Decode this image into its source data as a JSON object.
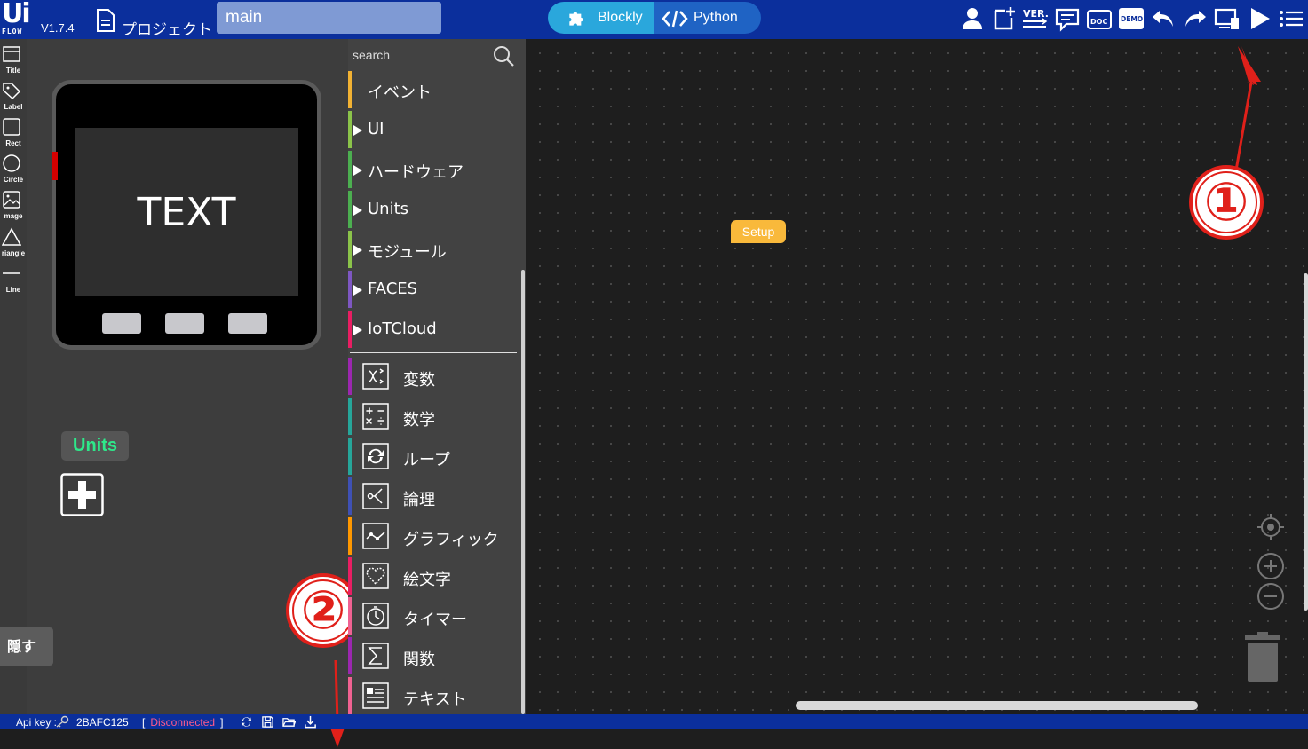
{
  "header": {
    "logo_ui": "Ui",
    "logo_flow": "FLOW",
    "version": "V1.7.4",
    "project_label": "プロジェクト",
    "filename": "main",
    "mode_blockly": "Blockly",
    "mode_python": "Python",
    "toolbar_icons": [
      "user-icon",
      "new-file-icon",
      "version-icon",
      "message-icon",
      "doc-icon",
      "demo-icon",
      "undo-icon",
      "redo-icon",
      "device-icon",
      "run-icon",
      "menu-icon"
    ],
    "ver_text": "VER.",
    "doc_text": "DOC",
    "demo_text": "DEMO"
  },
  "tools": [
    {
      "name": "Title",
      "icon": "title-icon"
    },
    {
      "name": "Label",
      "icon": "label-icon"
    },
    {
      "name": "Rect",
      "icon": "rect-icon"
    },
    {
      "name": "Circle",
      "icon": "circle-icon"
    },
    {
      "name": "mage",
      "icon": "image-icon"
    },
    {
      "name": "riangle",
      "icon": "triangle-icon"
    },
    {
      "name": "Line",
      "icon": "line-icon"
    }
  ],
  "device": {
    "screen_text": "TEXT",
    "units_label": "Units",
    "hide_label": "隠す"
  },
  "categories": {
    "search_placeholder": "search",
    "expandable": [
      {
        "label": "イベント",
        "color": "#f2b233",
        "arrow": false
      },
      {
        "label": "UI",
        "color": "#8bc34a",
        "arrow": true
      },
      {
        "label": "ハードウェア",
        "color": "#4caf50",
        "arrow": true
      },
      {
        "label": "Units",
        "color": "#4caf50",
        "arrow": true
      },
      {
        "label": "モジュール",
        "color": "#8bc34a",
        "arrow": true
      },
      {
        "label": "FACES",
        "color": "#7e57c2",
        "arrow": true
      },
      {
        "label": "IoTCloud",
        "color": "#e91e63",
        "arrow": true
      }
    ],
    "builtin": [
      {
        "label": "変数",
        "color": "#9c27b0",
        "icon": "variable-icon"
      },
      {
        "label": "数学",
        "color": "#26a69a",
        "icon": "math-icon"
      },
      {
        "label": "ループ",
        "color": "#26a69a",
        "icon": "loop-icon"
      },
      {
        "label": "論理",
        "color": "#3f51b5",
        "icon": "logic-icon"
      },
      {
        "label": "グラフィック",
        "color": "#ff9800",
        "icon": "graphic-icon"
      },
      {
        "label": "絵文字",
        "color": "#e91e63",
        "icon": "emoji-icon"
      },
      {
        "label": "タイマー",
        "color": "#f06292",
        "icon": "timer-icon"
      },
      {
        "label": "関数",
        "color": "#9c27b0",
        "icon": "function-icon"
      },
      {
        "label": "テキスト",
        "color": "#f06292",
        "icon": "text-icon"
      }
    ]
  },
  "workspace": {
    "setup_block": "Setup",
    "annotation_1": "①",
    "annotation_2": "②"
  },
  "status": {
    "api_label": "Api key :",
    "api_key": "2BAFC125",
    "bracket_open": "[",
    "connection": "Disconnected",
    "bracket_close": "]",
    "icons": [
      "sync-icon",
      "save-icon",
      "folder-icon",
      "download-icon"
    ]
  },
  "colors": {
    "topbar": "#0b2f9c",
    "blockly": "#2aa7dc",
    "python": "#1f63c4",
    "setup": "#f9b93b",
    "units_text": "#2ee88a",
    "disconnected": "#ff5b8a",
    "annotation": "#e0201a"
  }
}
